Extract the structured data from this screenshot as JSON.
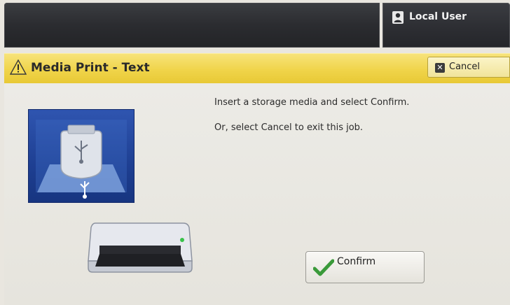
{
  "header": {
    "user_label": "Local User",
    "user_icon": "user-icon"
  },
  "titlebar": {
    "title": "Media Print - Text",
    "warning_icon": "warning-icon",
    "cancel_label": "Cancel"
  },
  "main": {
    "message_line1": "Insert a storage media and select Confirm.",
    "message_line2": "Or, select Cancel to exit this job.",
    "confirm_label": "Confirm"
  },
  "colors": {
    "title_yellow": "#f0d44a",
    "usb_tile_blue": "#1e3f92",
    "confirm_check_green": "#3a9a3a"
  }
}
